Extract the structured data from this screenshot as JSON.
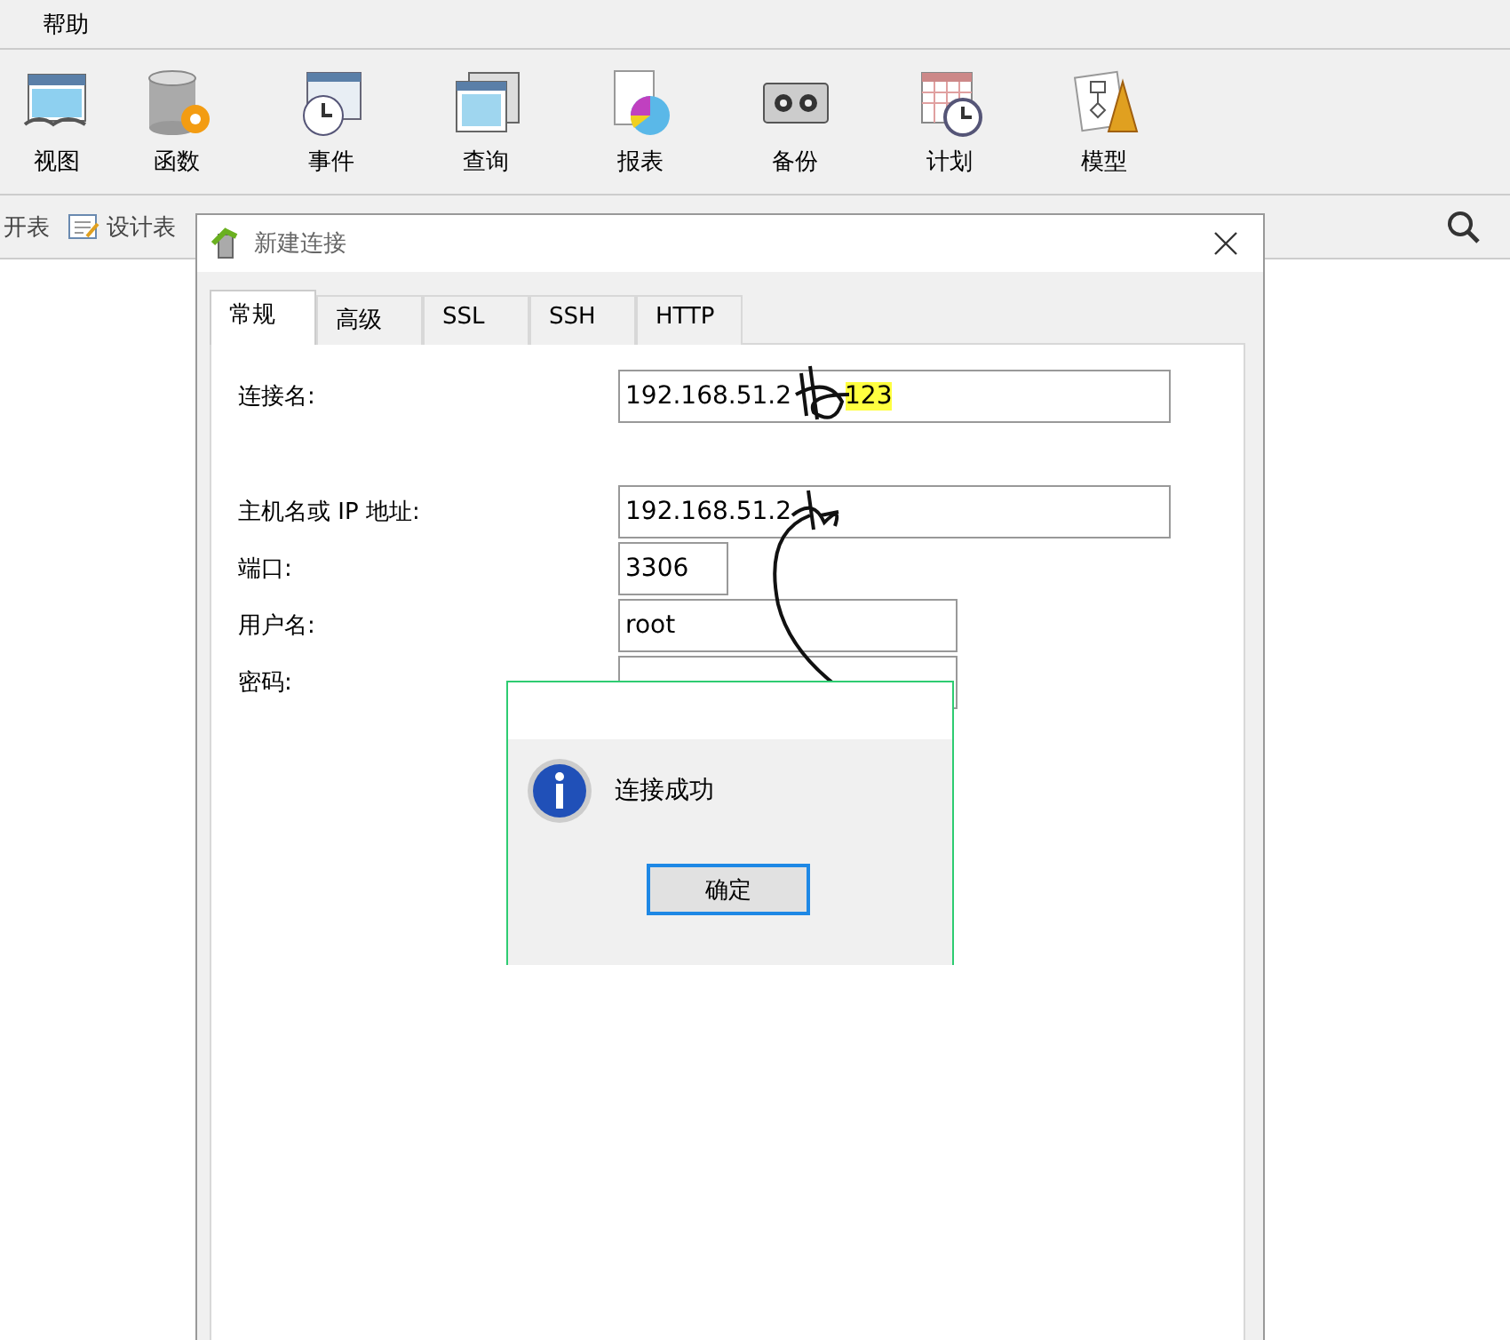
{
  "menu_bar": {
    "items": [
      "帮助"
    ]
  },
  "toolbar": {
    "items": [
      {
        "label": "视图"
      },
      {
        "label": "函数"
      },
      {
        "label": "事件"
      },
      {
        "label": "查询"
      },
      {
        "label": "报表"
      },
      {
        "label": "备份"
      },
      {
        "label": "计划"
      },
      {
        "label": "模型"
      }
    ]
  },
  "sub_toolbar": {
    "items": [
      "开表",
      "设计表"
    ]
  },
  "dialog": {
    "title": "新建连接",
    "tabs": [
      {
        "label": "常规",
        "selected": true
      },
      {
        "label": "高级",
        "selected": false
      },
      {
        "label": "SSL",
        "selected": false
      },
      {
        "label": "SSH",
        "selected": false
      },
      {
        "label": "HTTP",
        "selected": false
      }
    ],
    "fields": [
      {
        "label": "连接名:",
        "value": "192.168.51.2",
        "highlighted_value": "123",
        "kind": "wide"
      },
      {
        "label": "主机名或 IP 地址:",
        "value": "192.168.51.2",
        "kind": "wide"
      },
      {
        "label": "端口:",
        "value": "3306",
        "kind": "small"
      },
      {
        "label": "用户名:",
        "value": "root",
        "kind": "medium"
      },
      {
        "label": "密码:",
        "kind": "medium"
      }
    ]
  },
  "message_box": {
    "message": "连接成功",
    "button": "确定"
  }
}
